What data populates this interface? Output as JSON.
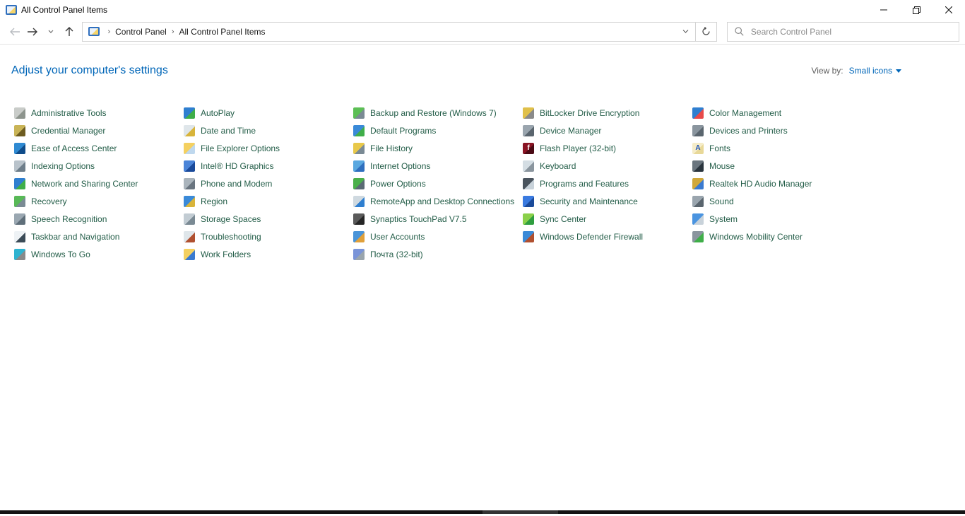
{
  "window": {
    "title": "All Control Panel Items"
  },
  "toolbar": {
    "breadcrumb": [
      "Control Panel",
      "All Control Panel Items"
    ],
    "search_placeholder": "Search Control Panel"
  },
  "header": {
    "title": "Adjust your computer's settings",
    "view_by_label": "View by:",
    "view_by_value": "Small icons"
  },
  "colors": {
    "link_text": "#235d48",
    "accent_blue": "#0066b8",
    "border_gray": "#d4d4d4"
  },
  "items": {
    "columns": [
      [
        {
          "label": "Administrative Tools",
          "icon": "administrative-tools-icon",
          "c1": "#c9ccc9",
          "c2": "#8d948d",
          "glyph": "",
          "glyph_color": ""
        },
        {
          "label": "Credential Manager",
          "icon": "credential-manager-icon",
          "c1": "#c9b457",
          "c2": "#6d5c20",
          "glyph": "",
          "glyph_color": ""
        },
        {
          "label": "Ease of Access Center",
          "icon": "ease-of-access-icon",
          "c1": "#2f8ad2",
          "c2": "#0f4c8a",
          "glyph": "",
          "glyph_color": ""
        },
        {
          "label": "Indexing Options",
          "icon": "indexing-options-icon",
          "c1": "#b9c3cb",
          "c2": "#6e7e8a",
          "glyph": "",
          "glyph_color": ""
        },
        {
          "label": "Network and Sharing Center",
          "icon": "network-sharing-icon",
          "c1": "#2f7fd0",
          "c2": "#3fae49",
          "glyph": "",
          "glyph_color": ""
        },
        {
          "label": "Recovery",
          "icon": "recovery-icon",
          "c1": "#58b957",
          "c2": "#7a8a94",
          "glyph": "",
          "glyph_color": ""
        },
        {
          "label": "Speech Recognition",
          "icon": "speech-recognition-icon",
          "c1": "#9aa7b1",
          "c2": "#5f6f7a",
          "glyph": "",
          "glyph_color": ""
        },
        {
          "label": "Taskbar and Navigation",
          "icon": "taskbar-navigation-icon",
          "c1": "#eef2f5",
          "c2": "#3b4b57",
          "glyph": "",
          "glyph_color": ""
        },
        {
          "label": "Windows To Go",
          "icon": "windows-to-go-icon",
          "c1": "#2fb3d0",
          "c2": "#8a8a8a",
          "glyph": "",
          "glyph_color": ""
        }
      ],
      [
        {
          "label": "AutoPlay",
          "icon": "autoplay-icon",
          "c1": "#2f7fd0",
          "c2": "#3fae49",
          "glyph": "",
          "glyph_color": ""
        },
        {
          "label": "Date and Time",
          "icon": "date-time-icon",
          "c1": "#dfe6ea",
          "c2": "#d8b43a",
          "glyph": "",
          "glyph_color": ""
        },
        {
          "label": "File Explorer Options",
          "icon": "file-explorer-options-icon",
          "c1": "#f4d060",
          "c2": "#bfd8ee",
          "glyph": "",
          "glyph_color": ""
        },
        {
          "label": "Intel® HD Graphics",
          "icon": "intel-hd-graphics-icon",
          "c1": "#4a84d8",
          "c2": "#1a4a9a",
          "glyph": "",
          "glyph_color": ""
        },
        {
          "label": "Phone and Modem",
          "icon": "phone-modem-icon",
          "c1": "#aab4bc",
          "c2": "#6a7580",
          "glyph": "",
          "glyph_color": ""
        },
        {
          "label": "Region",
          "icon": "region-icon",
          "c1": "#3a8ad8",
          "c2": "#d8b43a",
          "glyph": "",
          "glyph_color": ""
        },
        {
          "label": "Storage Spaces",
          "icon": "storage-spaces-icon",
          "c1": "#c2ccd3",
          "c2": "#7a8a94",
          "glyph": "",
          "glyph_color": ""
        },
        {
          "label": "Troubleshooting",
          "icon": "troubleshooting-icon",
          "c1": "#dfe6ea",
          "c2": "#b05030",
          "glyph": "",
          "glyph_color": ""
        },
        {
          "label": "Work Folders",
          "icon": "work-folders-icon",
          "c1": "#f4d060",
          "c2": "#3a7ad0",
          "glyph": "",
          "glyph_color": ""
        }
      ],
      [
        {
          "label": "Backup and Restore (Windows 7)",
          "icon": "backup-restore-icon",
          "c1": "#5cbf55",
          "c2": "#7a8a94",
          "glyph": "",
          "glyph_color": ""
        },
        {
          "label": "Default Programs",
          "icon": "default-programs-icon",
          "c1": "#3a8ad8",
          "c2": "#3fae49",
          "glyph": "",
          "glyph_color": ""
        },
        {
          "label": "File History",
          "icon": "file-history-icon",
          "c1": "#e8c84a",
          "c2": "#7a8a94",
          "glyph": "",
          "glyph_color": ""
        },
        {
          "label": "Internet Options",
          "icon": "internet-options-icon",
          "c1": "#5aa8e0",
          "c2": "#2f6fbe",
          "glyph": "",
          "glyph_color": ""
        },
        {
          "label": "Power Options",
          "icon": "power-options-icon",
          "c1": "#4ab04a",
          "c2": "#5a6a74",
          "glyph": "",
          "glyph_color": ""
        },
        {
          "label": "RemoteApp and Desktop Connections",
          "icon": "remoteapp-icon",
          "c1": "#cfd9e0",
          "c2": "#2f7fd0",
          "glyph": "",
          "glyph_color": ""
        },
        {
          "label": "Synaptics TouchPad V7.5",
          "icon": "synaptics-touchpad-icon",
          "c1": "#5a5a5a",
          "c2": "#262626",
          "glyph": "",
          "glyph_color": ""
        },
        {
          "label": "User Accounts",
          "icon": "user-accounts-icon",
          "c1": "#4a94d8",
          "c2": "#e0a03a",
          "glyph": "",
          "glyph_color": ""
        },
        {
          "label": "Почта (32-bit)",
          "icon": "mail-icon",
          "c1": "#7a94d8",
          "c2": "#9aa5ad",
          "glyph": "",
          "glyph_color": ""
        }
      ],
      [
        {
          "label": "BitLocker Drive Encryption",
          "icon": "bitlocker-icon",
          "c1": "#e0c04a",
          "c2": "#8a8a8a",
          "glyph": "",
          "glyph_color": ""
        },
        {
          "label": "Device Manager",
          "icon": "device-manager-icon",
          "c1": "#9aa5ae",
          "c2": "#5a656e",
          "glyph": "",
          "glyph_color": ""
        },
        {
          "label": "Flash Player (32-bit)",
          "icon": "flash-player-icon",
          "c1": "#8a1424",
          "c2": "#4a0a14",
          "glyph": "f",
          "glyph_color": "#ffffff"
        },
        {
          "label": "Keyboard",
          "icon": "keyboard-icon",
          "c1": "#d4dde3",
          "c2": "#8a959e",
          "glyph": "",
          "glyph_color": ""
        },
        {
          "label": "Programs and Features",
          "icon": "programs-features-icon",
          "c1": "#4a545e",
          "c2": "#c8d2da",
          "glyph": "",
          "glyph_color": ""
        },
        {
          "label": "Security and Maintenance",
          "icon": "security-maintenance-icon",
          "c1": "#3a7ae0",
          "c2": "#1a4a9a",
          "glyph": "",
          "glyph_color": ""
        },
        {
          "label": "Sync Center",
          "icon": "sync-center-icon",
          "c1": "#8ad04a",
          "c2": "#2f9e3f",
          "glyph": "",
          "glyph_color": ""
        },
        {
          "label": "Windows Defender Firewall",
          "icon": "windows-defender-firewall-icon",
          "c1": "#3a8ad8",
          "c2": "#b05030",
          "glyph": "",
          "glyph_color": ""
        }
      ],
      [
        {
          "label": "Color Management",
          "icon": "color-management-icon",
          "c1": "#2f7fd0",
          "c2": "#e84a4a",
          "glyph": "",
          "glyph_color": ""
        },
        {
          "label": "Devices and Printers",
          "icon": "devices-printers-icon",
          "c1": "#8a959e",
          "c2": "#5a656e",
          "glyph": "",
          "glyph_color": ""
        },
        {
          "label": "Fonts",
          "icon": "fonts-icon",
          "c1": "#f5ecc8",
          "c2": "#e8d898",
          "glyph": "A",
          "glyph_color": "#1a50b8"
        },
        {
          "label": "Mouse",
          "icon": "mouse-icon",
          "c1": "#6a757e",
          "c2": "#2a353e",
          "glyph": "",
          "glyph_color": ""
        },
        {
          "label": "Realtek HD Audio Manager",
          "icon": "realtek-audio-icon",
          "c1": "#d0a83a",
          "c2": "#3a7ad0",
          "glyph": "",
          "glyph_color": ""
        },
        {
          "label": "Sound",
          "icon": "sound-icon",
          "c1": "#9aa5ae",
          "c2": "#5a656e",
          "glyph": "",
          "glyph_color": ""
        },
        {
          "label": "System",
          "icon": "system-icon",
          "c1": "#4a94e0",
          "c2": "#c8d2da",
          "glyph": "",
          "glyph_color": ""
        },
        {
          "label": "Windows Mobility Center",
          "icon": "windows-mobility-icon",
          "c1": "#8a959e",
          "c2": "#3fae49",
          "glyph": "",
          "glyph_color": ""
        }
      ]
    ]
  }
}
